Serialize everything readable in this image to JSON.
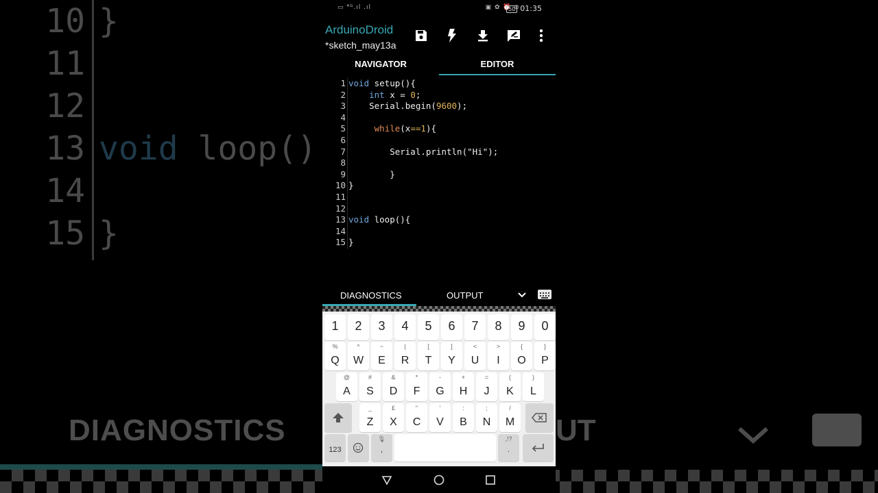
{
  "status_bar": {
    "left_icons": "▭ ⁴ᴳ.ıl .ıl",
    "right_icons": "▣ ✿ ⏰ ⊘",
    "battery": "50",
    "time": "01:35"
  },
  "app": {
    "title": "ArduinoDroid",
    "subtitle": "*sketch_may13a",
    "toolbar": [
      "save-icon",
      "flash-icon",
      "download-icon",
      "edit-note-icon",
      "more-icon"
    ]
  },
  "tabs": {
    "navigator": "NAVIGATOR",
    "editor": "EDITOR",
    "active": "editor"
  },
  "editor": {
    "lines": [
      {
        "n": "1",
        "text": "void setup(){"
      },
      {
        "n": "2",
        "text": "    int x = 0;"
      },
      {
        "n": "3",
        "text": "    Serial.begin(9600);"
      },
      {
        "n": "4",
        "text": ""
      },
      {
        "n": "5",
        "text": "     while(x==1){"
      },
      {
        "n": "6",
        "text": ""
      },
      {
        "n": "7",
        "text": "        Serial.println(\"Hi\");"
      },
      {
        "n": "8",
        "text": ""
      },
      {
        "n": "9",
        "text": "        }"
      },
      {
        "n": "10",
        "text": "}"
      },
      {
        "n": "11",
        "text": ""
      },
      {
        "n": "12",
        "text": ""
      },
      {
        "n": "13",
        "text": "void loop(){"
      },
      {
        "n": "14",
        "text": ""
      },
      {
        "n": "15",
        "text": "}"
      }
    ]
  },
  "bottom_panel": {
    "diagnostics": "DIAGNOSTICS",
    "output": "OUTPUT",
    "active": "diagnostics"
  },
  "keyboard": {
    "row_numbers": [
      "1",
      "2",
      "3",
      "4",
      "5",
      "6",
      "7",
      "8",
      "9",
      "0"
    ],
    "row_q": [
      {
        "k": "Q",
        "a": "%"
      },
      {
        "k": "W",
        "a": "^"
      },
      {
        "k": "E",
        "a": "~"
      },
      {
        "k": "R",
        "a": "|"
      },
      {
        "k": "T",
        "a": "["
      },
      {
        "k": "Y",
        "a": "]"
      },
      {
        "k": "U",
        "a": "<"
      },
      {
        "k": "I",
        "a": ">"
      },
      {
        "k": "O",
        "a": "{"
      },
      {
        "k": "P",
        "a": "}"
      }
    ],
    "row_a": [
      {
        "k": "A",
        "a": "@"
      },
      {
        "k": "S",
        "a": "#"
      },
      {
        "k": "D",
        "a": "&"
      },
      {
        "k": "F",
        "a": "*"
      },
      {
        "k": "G",
        "a": "-"
      },
      {
        "k": "H",
        "a": "+"
      },
      {
        "k": "J",
        "a": "="
      },
      {
        "k": "K",
        "a": "("
      },
      {
        "k": "L",
        "a": ")"
      }
    ],
    "row_z": [
      {
        "k": "Z",
        "a": "_"
      },
      {
        "k": "X",
        "a": "£"
      },
      {
        "k": "C",
        "a": "\""
      },
      {
        "k": "V",
        "a": "'"
      },
      {
        "k": "B",
        "a": ":"
      },
      {
        "k": "N",
        "a": ";"
      },
      {
        "k": "M",
        "a": "/"
      }
    ],
    "symbols_label": "123",
    "comma": ",",
    "comma_alt": "🎙",
    "period": ".",
    "period_alt": ",!?"
  },
  "background_zoom": {
    "lines": [
      {
        "n": "10",
        "text": "}"
      },
      {
        "n": "11",
        "text": ""
      },
      {
        "n": "12",
        "text": ""
      },
      {
        "n": "13",
        "text": "void loop()"
      },
      {
        "n": "14",
        "text": ""
      },
      {
        "n": "15",
        "text": "}"
      }
    ],
    "diagnostics": "DIAGNOSTICS",
    "output_fragment": "UT"
  },
  "colors": {
    "accent": "#38a9b5",
    "keyword": "#6fa8dc",
    "number": "#e0b45b",
    "control": "#e08a5a"
  }
}
